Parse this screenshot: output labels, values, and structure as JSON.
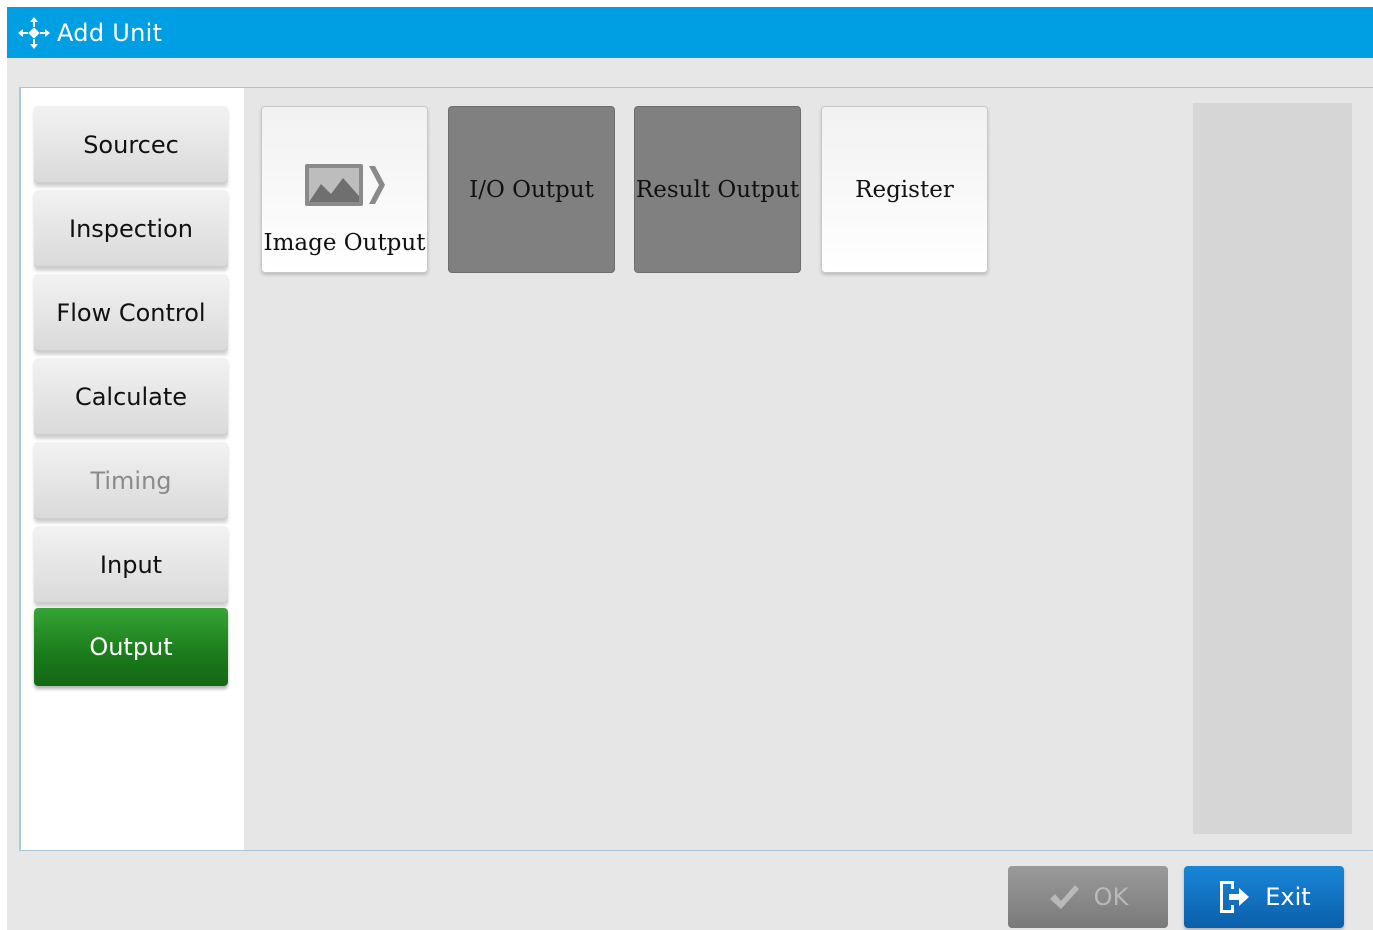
{
  "window": {
    "title": "Add Unit",
    "title_icon": "move-arrows-icon"
  },
  "categories": [
    {
      "label": "Sourcec",
      "state": "normal"
    },
    {
      "label": "Inspection",
      "state": "normal"
    },
    {
      "label": "Flow Control",
      "state": "normal"
    },
    {
      "label": "Calculate",
      "state": "normal"
    },
    {
      "label": "Timing",
      "state": "disabled"
    },
    {
      "label": "Input",
      "state": "normal"
    },
    {
      "label": "Output",
      "state": "selected"
    }
  ],
  "units": [
    {
      "label": "Image Output",
      "icon": "image-output-icon",
      "state": "enabled"
    },
    {
      "label": "I/O Output",
      "state": "disabled"
    },
    {
      "label": "Result Output",
      "state": "disabled"
    },
    {
      "label": "Register",
      "state": "enabled"
    }
  ],
  "footer": {
    "ok_label": "OK",
    "ok_state": "disabled",
    "ok_icon": "checkmark-icon",
    "exit_label": "Exit",
    "exit_icon": "exit-door-icon"
  },
  "colors": {
    "title_bar": "#009fe3",
    "selected_category": "#1b7a1b",
    "disabled_unit": "#808080",
    "exit_button": "#0b5faa"
  }
}
